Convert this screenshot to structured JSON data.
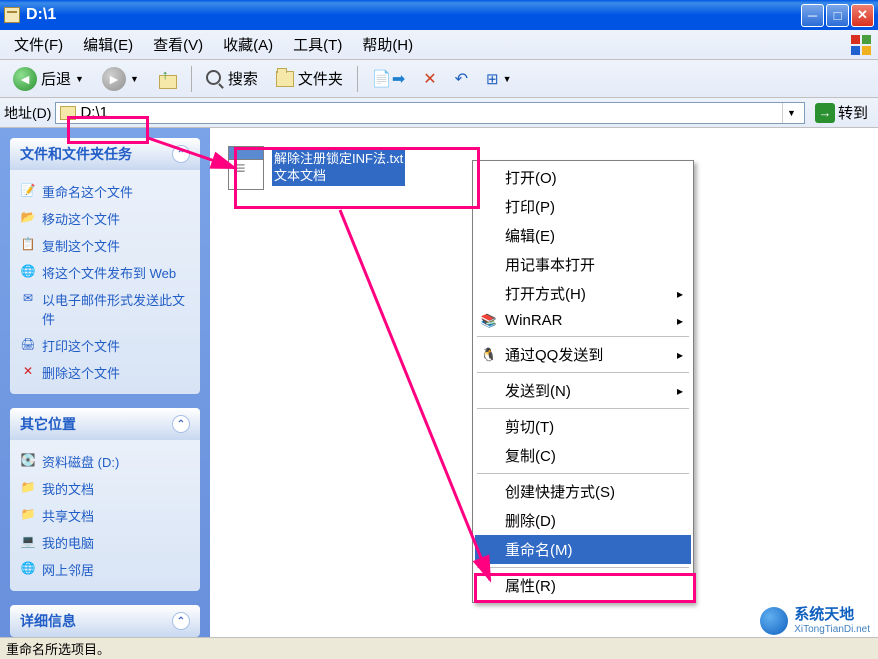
{
  "window": {
    "title": "D:\\1"
  },
  "menubar": {
    "file": "文件(F)",
    "edit": "编辑(E)",
    "view": "查看(V)",
    "favorites": "收藏(A)",
    "tools": "工具(T)",
    "help": "帮助(H)"
  },
  "toolbar": {
    "back": "后退",
    "search": "搜索",
    "folders": "文件夹"
  },
  "addressbar": {
    "label": "地址(D)",
    "value": "D:\\1",
    "go": "转到"
  },
  "sidebar": {
    "tasks": {
      "title": "文件和文件夹任务",
      "items": [
        {
          "icon": "rename-icon",
          "label": "重命名这个文件"
        },
        {
          "icon": "move-icon",
          "label": "移动这个文件"
        },
        {
          "icon": "copy-icon",
          "label": "复制这个文件"
        },
        {
          "icon": "publish-icon",
          "label": "将这个文件发布到 Web"
        },
        {
          "icon": "email-icon",
          "label": "以电子邮件形式发送此文件"
        },
        {
          "icon": "print-icon",
          "label": "打印这个文件"
        },
        {
          "icon": "delete-icon",
          "label": "删除这个文件"
        }
      ]
    },
    "other": {
      "title": "其它位置",
      "items": [
        {
          "icon": "disk-icon",
          "label": "资料磁盘 (D:)"
        },
        {
          "icon": "mydocs-icon",
          "label": "我的文档"
        },
        {
          "icon": "shared-icon",
          "label": "共享文档"
        },
        {
          "icon": "mycomputer-icon",
          "label": "我的电脑"
        },
        {
          "icon": "network-icon",
          "label": "网上邻居"
        }
      ]
    },
    "details": {
      "title": "详细信息"
    }
  },
  "file": {
    "name": "解除注册锁定INF法.txt",
    "type": "文本文档"
  },
  "context_menu": {
    "open": "打开(O)",
    "print": "打印(P)",
    "edit": "编辑(E)",
    "notepad": "用记事本打开",
    "openwith": "打开方式(H)",
    "winrar": "WinRAR",
    "qq": "通过QQ发送到",
    "sendto": "发送到(N)",
    "cut": "剪切(T)",
    "copy": "复制(C)",
    "shortcut": "创建快捷方式(S)",
    "delete": "删除(D)",
    "rename": "重命名(M)",
    "properties": "属性(R)"
  },
  "statusbar": {
    "text": "重命名所选项目。"
  },
  "watermark": {
    "main": "系统天地",
    "sub": "XiTongTianDi.net"
  }
}
